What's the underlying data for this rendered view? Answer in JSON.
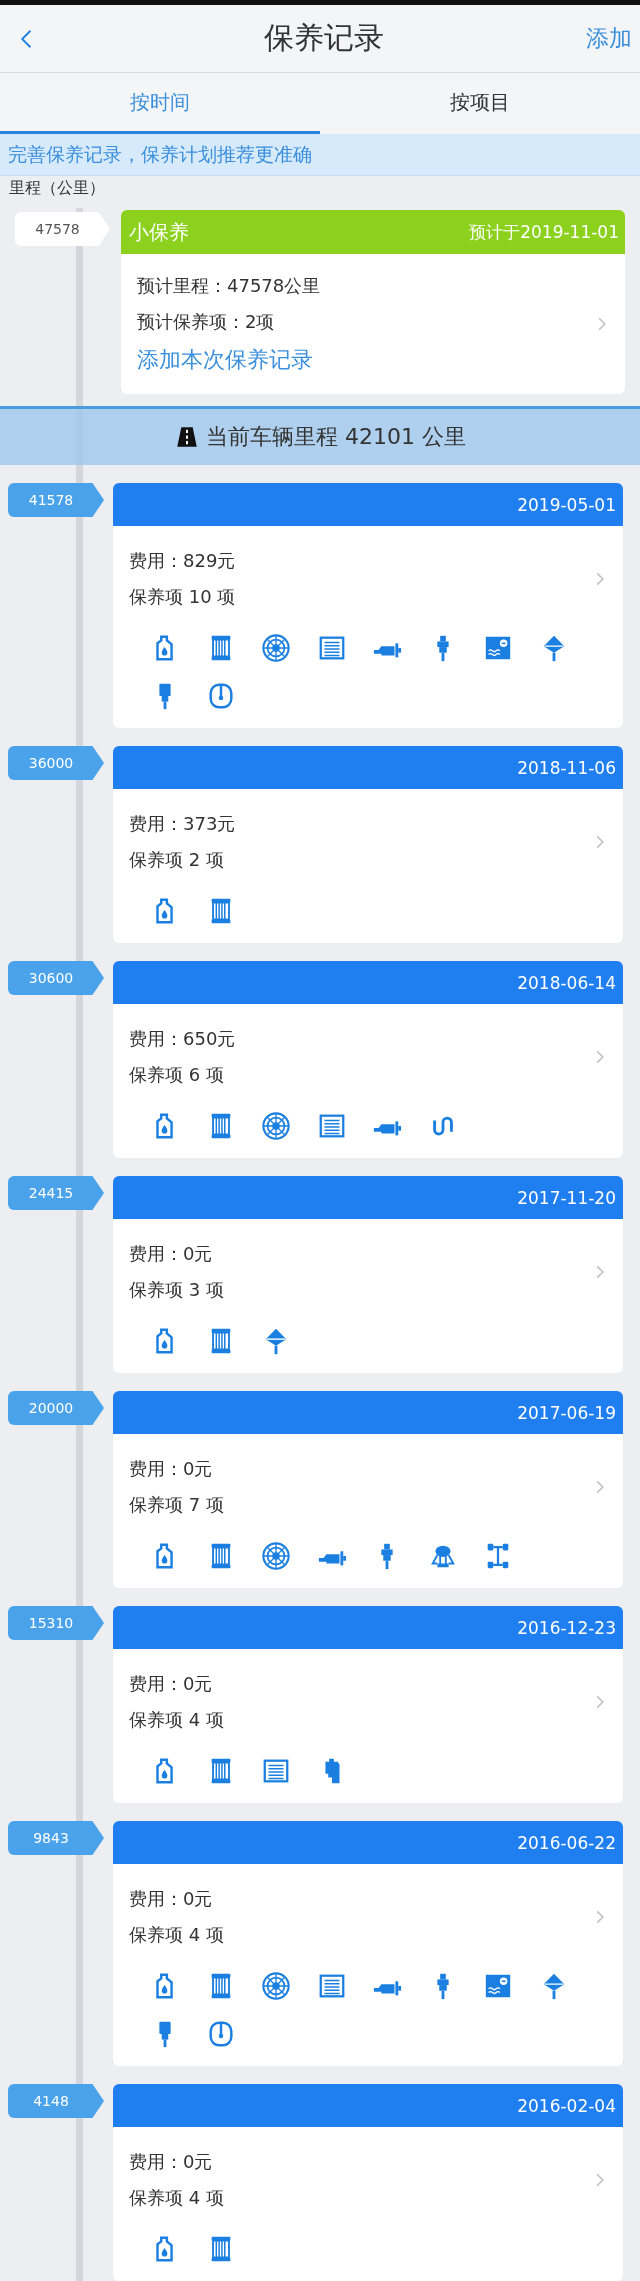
{
  "header": {
    "title": "保养记录",
    "action": "添加"
  },
  "tabs": [
    {
      "label": "按时间",
      "selected": true
    },
    {
      "label": "按项目",
      "selected": false
    }
  ],
  "notice": "完善保养记录，保养计划推荐更准确",
  "axis_label": "里程（公里）",
  "upcoming": {
    "mileage": "47578",
    "title": "小保养",
    "due": "预计于2019-11-01",
    "lines": [
      "预计里程：47578公里",
      "预计保养项：2项"
    ],
    "link": "添加本次保养记录"
  },
  "current_mileage": "当前车辆里程 42101 公里",
  "records": [
    {
      "mileage": "41578",
      "date": "2019-05-01",
      "cost": "费用：829元",
      "count": "保养项 10 项",
      "items": [
        {
          "kind": "oil"
        },
        {
          "kind": "filter"
        },
        {
          "kind": "fan"
        },
        {
          "kind": "grille"
        },
        {
          "kind": "pump"
        },
        {
          "kind": "plug"
        },
        {
          "kind": "coolant"
        },
        {
          "kind": "top"
        },
        {
          "kind": "stem"
        },
        {
          "kind": "clamp"
        }
      ]
    },
    {
      "mileage": "36000",
      "date": "2018-11-06",
      "cost": "费用：373元",
      "count": "保养项 2 项",
      "items": [
        {
          "kind": "oil"
        },
        {
          "kind": "filter"
        }
      ]
    },
    {
      "mileage": "30600",
      "date": "2018-06-14",
      "cost": "费用：650元",
      "count": "保养项 6 项",
      "items": [
        {
          "kind": "oil"
        },
        {
          "kind": "filter"
        },
        {
          "kind": "fan"
        },
        {
          "kind": "grille"
        },
        {
          "kind": "pump"
        },
        {
          "kind": "hook"
        }
      ]
    },
    {
      "mileage": "24415",
      "date": "2017-11-20",
      "cost": "费用：0元",
      "count": "保养项 3 项",
      "items": [
        {
          "kind": "oil"
        },
        {
          "kind": "filter"
        },
        {
          "kind": "top"
        }
      ]
    },
    {
      "mileage": "20000",
      "date": "2017-06-19",
      "cost": "费用：0元",
      "count": "保养项 7 项",
      "items": [
        {
          "kind": "oil"
        },
        {
          "kind": "filter"
        },
        {
          "kind": "fan"
        },
        {
          "kind": "pump"
        },
        {
          "kind": "plug"
        },
        {
          "kind": "dome"
        },
        {
          "kind": "frame"
        }
      ]
    },
    {
      "mileage": "15310",
      "date": "2016-12-23",
      "cost": "费用：0元",
      "count": "保养项 4 项",
      "items": [
        {
          "kind": "oil"
        },
        {
          "kind": "filter"
        },
        {
          "kind": "grille"
        },
        {
          "kind": "can"
        }
      ]
    },
    {
      "mileage": "9843",
      "date": "2016-06-22",
      "cost": "费用：0元",
      "count": "保养项 4 项",
      "items": [
        {
          "kind": "oil"
        },
        {
          "kind": "filter"
        },
        {
          "kind": "fan"
        },
        {
          "kind": "grille"
        },
        {
          "kind": "pump"
        },
        {
          "kind": "plug"
        },
        {
          "kind": "coolant"
        },
        {
          "kind": "top"
        },
        {
          "kind": "stem"
        },
        {
          "kind": "clamp"
        }
      ]
    },
    {
      "mileage": "4148",
      "date": "2016-02-04",
      "cost": "费用：0元",
      "count": "保养项 4 项",
      "items": [
        {
          "kind": "oil"
        },
        {
          "kind": "filter"
        }
      ]
    }
  ]
}
